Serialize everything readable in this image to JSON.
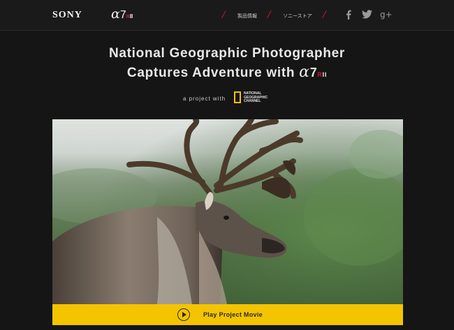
{
  "header": {
    "brand": "SONY",
    "model": {
      "alpha": "α",
      "number": "7",
      "r": "R",
      "suffix": "II"
    },
    "nav": [
      "製品情報",
      "ソニーストア"
    ],
    "social": [
      {
        "name": "facebook-icon",
        "glyph": "f"
      },
      {
        "name": "twitter-icon",
        "glyph": "🐦"
      },
      {
        "name": "google-plus-icon",
        "glyph": "g+"
      }
    ]
  },
  "hero": {
    "title_line1": "National Geographic Photographer",
    "title_line2_prefix": "Captures Adventure with",
    "project_with": "a project with",
    "partner": {
      "line1": "NATIONAL",
      "line2": "GEOGRAPHIC",
      "line3": "CHANNEL"
    },
    "play_label": "Play Project Movie"
  },
  "colors": {
    "accent": "#f4c400",
    "brand_red": "#b21e2a",
    "background": "#151515"
  }
}
